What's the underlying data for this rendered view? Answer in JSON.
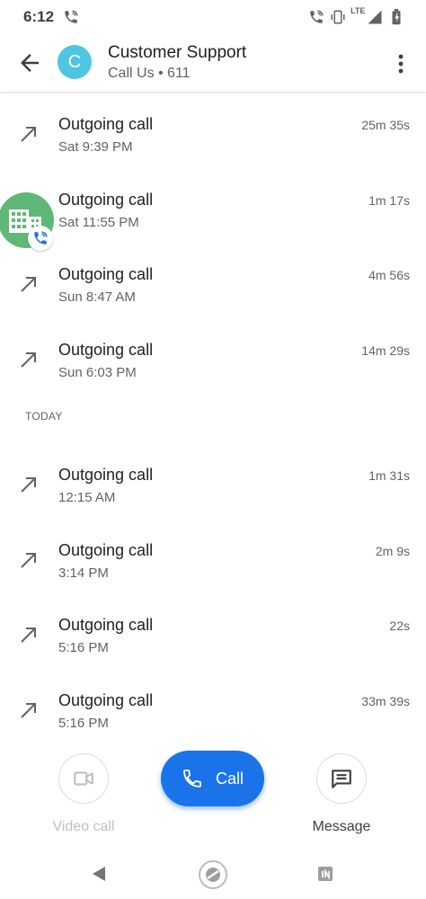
{
  "status_bar": {
    "time": "6:12",
    "network": "LTE"
  },
  "header": {
    "avatar_letter": "C",
    "title": "Customer Support",
    "subtitle": "Call Us • 611"
  },
  "calls_earlier": [
    {
      "type": "Outgoing call",
      "when": "Sat 9:39 PM",
      "duration": "25m 35s"
    },
    {
      "type": "Outgoing call",
      "when": "Sat 11:55 PM",
      "duration": "1m 17s"
    },
    {
      "type": "Outgoing call",
      "when": "Sun 8:47 AM",
      "duration": "4m 56s"
    },
    {
      "type": "Outgoing call",
      "when": "Sun 6:03 PM",
      "duration": "14m 29s"
    }
  ],
  "section_today": "TODAY",
  "calls_today": [
    {
      "type": "Outgoing call",
      "when": "12:15 AM",
      "duration": "1m 31s"
    },
    {
      "type": "Outgoing call",
      "when": "3:14 PM",
      "duration": "2m 9s"
    },
    {
      "type": "Outgoing call",
      "when": "5:16 PM",
      "duration": "22s"
    },
    {
      "type": "Outgoing call",
      "when": "5:16 PM",
      "duration": "33m 39s"
    }
  ],
  "actions": {
    "video_call_label": "Video call",
    "call_label": "Call",
    "message_label": "Message"
  },
  "colors": {
    "accent": "#1a73e8",
    "avatar": "#4ec5e3",
    "bubble": "#5fb878"
  }
}
